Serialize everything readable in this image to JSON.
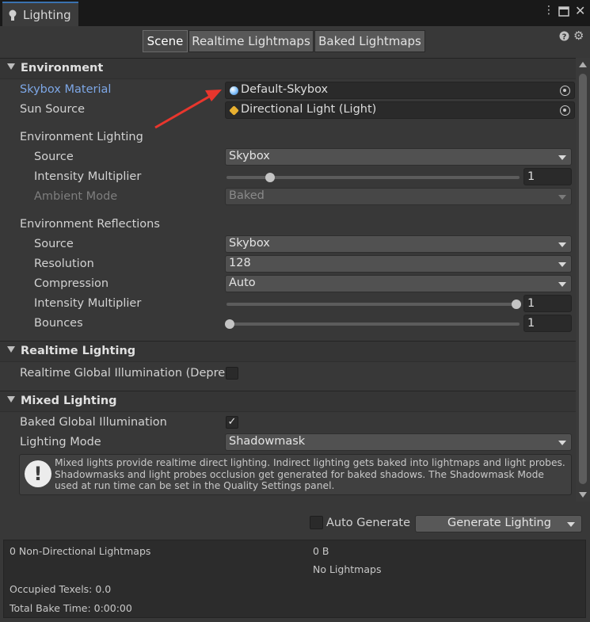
{
  "window": {
    "tab_title": "Lighting",
    "icons": [
      "more-vert-icon",
      "maximize-icon",
      "close-icon"
    ]
  },
  "tabs": [
    {
      "label": "Scene",
      "active": true
    },
    {
      "label": "Realtime Lightmaps",
      "active": false
    },
    {
      "label": "Baked Lightmaps",
      "active": false
    }
  ],
  "sections": {
    "environment": "Environment",
    "realtime": "Realtime Lighting",
    "mixed": "Mixed Lighting"
  },
  "environment": {
    "skybox_label": "Skybox Material",
    "skybox_value": "Default-Skybox",
    "sun_label": "Sun Source",
    "sun_value": "Directional Light (Light)",
    "lighting_label": "Environment Lighting",
    "source_label": "Source",
    "source_value": "Skybox",
    "intensity_label": "Intensity Multiplier",
    "intensity_value": "1",
    "intensity_fraction": 0.14,
    "ambient_label": "Ambient Mode",
    "ambient_value": "Baked",
    "reflections_label": "Environment Reflections",
    "refl_source_label": "Source",
    "refl_source_value": "Skybox",
    "resolution_label": "Resolution",
    "resolution_value": "128",
    "compression_label": "Compression",
    "compression_value": "Auto",
    "refl_intensity_label": "Intensity Multiplier",
    "refl_intensity_value": "1",
    "refl_intensity_fraction": 1.0,
    "bounces_label": "Bounces",
    "bounces_value": "1",
    "bounces_fraction": 0.0
  },
  "realtime": {
    "gi_label": "Realtime Global Illumination (Deprec",
    "gi_checked": false
  },
  "mixed": {
    "baked_gi_label": "Baked Global Illumination",
    "baked_gi_checked": true,
    "mode_label": "Lighting Mode",
    "mode_value": "Shadowmask",
    "help_text": "Mixed lights provide realtime direct lighting. Indirect lighting gets baked into lightmaps and light probes. Shadowmasks and light probes occlusion get generated for baked shadows. The Shadowmask Mode used at run time can be set in the Quality Settings panel."
  },
  "footer": {
    "auto_generate_label": "Auto Generate",
    "auto_generate_checked": false,
    "generate_label": "Generate Lighting"
  },
  "stats": {
    "lightmaps": "0 Non-Directional Lightmaps",
    "size": "0 B",
    "no_lightmaps": "No Lightmaps",
    "texels": "Occupied Texels: 0.0",
    "bake_time": "Total Bake Time: 0:00:00"
  },
  "colors": {
    "accent": "#3a72b0",
    "link_label": "#7da7e6",
    "annotation_arrow": "#e8362d"
  }
}
